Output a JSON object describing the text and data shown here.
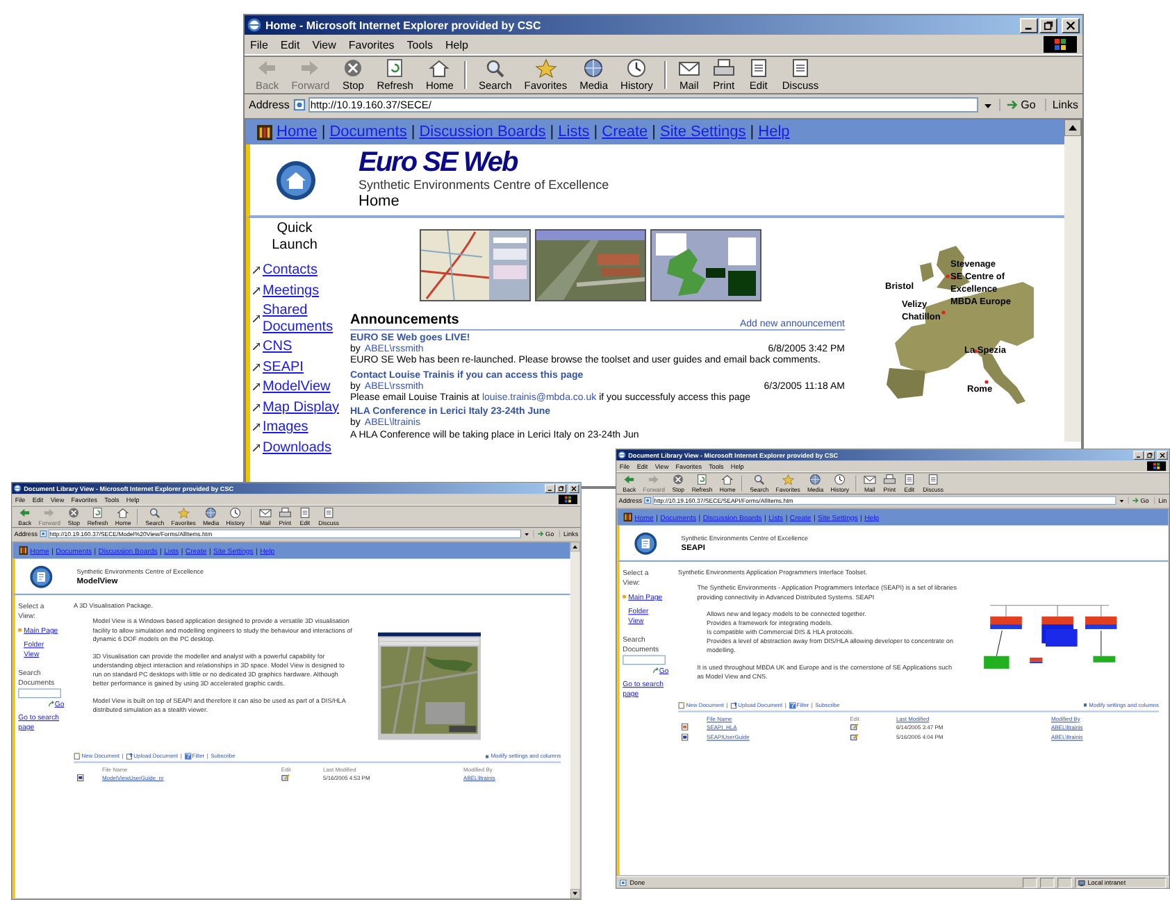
{
  "windows": [
    {
      "kind": "home",
      "title": "Home - Microsoft Internet Explorer provided by CSC",
      "menu": [
        "File",
        "Edit",
        "View",
        "Favorites",
        "Tools",
        "Help"
      ],
      "toolbar": [
        {
          "kind": "back",
          "label": "Back",
          "disabled": true
        },
        {
          "kind": "forward",
          "label": "Forward",
          "disabled": true
        },
        {
          "kind": "stop",
          "label": "Stop",
          "disabled": false
        },
        {
          "kind": "refresh",
          "label": "Refresh",
          "disabled": false
        },
        {
          "kind": "home",
          "label": "Home",
          "disabled": false
        },
        {
          "kind": "search",
          "label": "Search",
          "disabled": false
        },
        {
          "kind": "favorites",
          "label": "Favorites",
          "disabled": false
        },
        {
          "kind": "media",
          "label": "Media",
          "disabled": false
        },
        {
          "kind": "history",
          "label": "History",
          "disabled": false
        },
        {
          "kind": "mail",
          "label": "Mail",
          "disabled": false
        },
        {
          "kind": "print",
          "label": "Print",
          "disabled": false
        },
        {
          "kind": "edit",
          "label": "Edit",
          "disabled": false
        },
        {
          "kind": "discuss",
          "label": "Discuss",
          "disabled": false
        }
      ],
      "address": {
        "label": "Address",
        "url": "http://10.19.160.37/SECE/",
        "go": "Go",
        "links": "Links"
      },
      "nav": {
        "separator": "|",
        "links": [
          "Home",
          "Documents",
          "Discussion Boards",
          "Lists",
          "Create",
          "Site Settings",
          "Help"
        ]
      },
      "site_name": "Euro SE Web",
      "subtitle": "Synthetic Environments Centre of Excellence",
      "page_title": "Home",
      "quick_launch": {
        "heading": "Quick Launch",
        "links": [
          "Contacts",
          "Meetings",
          "Shared Documents",
          "CNS",
          "SEAPI",
          "ModelView",
          "Map Display",
          "Images",
          "Downloads"
        ]
      },
      "map_labels": [
        "Stevenage",
        "SE Centre of",
        "Excellence",
        "MBDA Europe",
        "Bristol",
        "Velizy",
        "Chatillon",
        "La Spezia",
        "Rome"
      ],
      "announcements": {
        "heading": "Announcements",
        "add_link": "Add new announcement",
        "items": [
          {
            "title": "EURO SE Web goes LIVE!",
            "by": "by",
            "author": "ABEL\\rssmith",
            "date": "6/8/2005 3:42 PM",
            "body": [
              {
                "text": "EURO SE Web has been re-launched.  Please browse the toolset and user guides and email back comments.",
                "link": false
              }
            ]
          },
          {
            "title": "Contact Louise Trainis if you can access this page",
            "by": "by",
            "author": "ABEL\\rssmith",
            "date": "6/3/2005 11:18 AM",
            "body": [
              {
                "text": "Please email Louise Trainis at ",
                "link": false
              },
              {
                "text": "louise.trainis@mbda.co.uk",
                "link": true
              },
              {
                "text": " if you successfuly access this page",
                "link": false
              }
            ]
          },
          {
            "title": "HLA Conference in Lerici Italy 23-24th June",
            "by": "by",
            "author": "ABEL\\ltrainis",
            "body": [
              {
                "text": "A HLA Conference will be taking place in Lerici Italy on 23-24th Jun",
                "link": false
              }
            ]
          }
        ]
      }
    },
    {
      "kind": "library",
      "title": "Document Library View - Microsoft Internet Explorer provided by CSC",
      "menu": [
        "File",
        "Edit",
        "View",
        "Favorites",
        "Tools",
        "Help"
      ],
      "toolbar": [
        {
          "kind": "back",
          "label": "Back",
          "disabled": false
        },
        {
          "kind": "forward",
          "label": "Forward",
          "disabled": true
        },
        {
          "kind": "stop",
          "label": "Stop",
          "disabled": false
        },
        {
          "kind": "refresh",
          "label": "Refresh",
          "disabled": false
        },
        {
          "kind": "home",
          "label": "Home",
          "disabled": false
        },
        {
          "kind": "search",
          "label": "Search",
          "disabled": false
        },
        {
          "kind": "favorites",
          "label": "Favorites",
          "disabled": false
        },
        {
          "kind": "media",
          "label": "Media",
          "disabled": false
        },
        {
          "kind": "history",
          "label": "History",
          "disabled": false
        },
        {
          "kind": "mail",
          "label": "Mail",
          "disabled": false
        },
        {
          "kind": "print",
          "label": "Print",
          "disabled": false
        },
        {
          "kind": "edit",
          "label": "Edit",
          "disabled": false
        },
        {
          "kind": "discuss",
          "label": "Discuss",
          "disabled": false
        }
      ],
      "address": {
        "label": "Address",
        "url": "http://10.19.160.37/SECE/Model%20View/Forms/AllItems.htm",
        "go": "Go",
        "links": "Links"
      },
      "nav": {
        "separator": "|",
        "links": [
          "Home",
          "Documents",
          "Discussion Boards",
          "Lists",
          "Create",
          "Site Settings",
          "Help"
        ]
      },
      "subtitle": "Synthetic Environments Centre of Excellence",
      "page_title": "ModelView",
      "select_view": {
        "heading": "Select a View:",
        "items": [
          {
            "label": "Main Page",
            "selected": true
          },
          {
            "label": "Folder View",
            "selected": false
          }
        ]
      },
      "search": {
        "heading": "Search Documents",
        "go": "Go",
        "search_page": "Go to search page"
      },
      "intro": "A 3D Visualisation Package.",
      "blocks": [
        {
          "kind": "para",
          "text": "Model View is a Windows based application designed to provide a versatile 3D visualisation facility to allow simulation and modelling engineers to study the behaviour and interactions of dynamic 6 DOF models on the PC desktop."
        },
        {
          "kind": "para",
          "text": "3D Visualisation can provide the modeller and analyst with a powerful capability for understanding object interaction and relationships in 3D space. Model View is designed to run on standard PC desktops with little or no dedicated 3D graphics hardware. Although better performance is gained by using 3D accelerated graphic cards."
        },
        {
          "kind": "para",
          "text": "Model View is built on top of SEAPI and therefore it can also be used as part of a DIS/HLA distributed simulation as a stealth viewer."
        }
      ],
      "figure": {
        "kind": "screenshot"
      },
      "doc_toolbar": {
        "separator": "|",
        "actions": [
          {
            "kind": "new",
            "label": "New Document"
          },
          {
            "kind": "upload",
            "label": "Upload Document"
          },
          {
            "kind": "filter",
            "label": "Filter"
          },
          {
            "kind": "subscribe",
            "label": "Subscribe"
          }
        ],
        "modify": "Modify settings and columns"
      },
      "table": {
        "columns": [
          {
            "label": "File Name",
            "sortable": false
          },
          {
            "label": "Edit",
            "sortable": false
          },
          {
            "label": "Last Modified",
            "sortable": false
          },
          {
            "label": "Modified By",
            "sortable": false
          }
        ],
        "rows": [
          {
            "kind": "doc",
            "file_name": "ModelViewUserGuide_nr",
            "modified": "5/16/2005 4:53 PM",
            "modified_by": "ABEL\\ltrainis"
          }
        ]
      }
    },
    {
      "kind": "library",
      "title": "Document Library View - Microsoft Internet Explorer provided by CSC",
      "menu": [
        "File",
        "Edit",
        "View",
        "Favorites",
        "Tools",
        "Help"
      ],
      "toolbar": [
        {
          "kind": "back",
          "label": "Back",
          "disabled": false
        },
        {
          "kind": "forward",
          "label": "Forward",
          "disabled": true
        },
        {
          "kind": "stop",
          "label": "Stop",
          "disabled": false
        },
        {
          "kind": "refresh",
          "label": "Refresh",
          "disabled": false
        },
        {
          "kind": "home",
          "label": "Home",
          "disabled": false
        },
        {
          "kind": "search",
          "label": "Search",
          "disabled": false
        },
        {
          "kind": "favorites",
          "label": "Favorites",
          "disabled": false
        },
        {
          "kind": "media",
          "label": "Media",
          "disabled": false
        },
        {
          "kind": "history",
          "label": "History",
          "disabled": false
        },
        {
          "kind": "mail",
          "label": "Mail",
          "disabled": false
        },
        {
          "kind": "print",
          "label": "Print",
          "disabled": false
        },
        {
          "kind": "edit",
          "label": "Edit",
          "disabled": false
        },
        {
          "kind": "discuss",
          "label": "Discuss",
          "disabled": false
        }
      ],
      "address": {
        "label": "Address",
        "url": "http://10.19.160.37/SECE/SEAPI/Forms/AllItems.htm",
        "go": "Go",
        "links": "Lin"
      },
      "nav": {
        "separator": "|",
        "links": [
          "Home",
          "Documents",
          "Discussion Boards",
          "Lists",
          "Create",
          "Site Settings",
          "Help"
        ]
      },
      "subtitle": "Synthetic Environments Centre of Excellence",
      "page_title": "SEAPI",
      "select_view": {
        "heading": "Select a View:",
        "items": [
          {
            "label": "Main Page",
            "selected": true
          },
          {
            "label": "Folder View",
            "selected": false
          }
        ]
      },
      "search": {
        "heading": "Search Documents",
        "go": "Go",
        "search_page": "Go to search page"
      },
      "intro": "Synthetic Environments Application Programmers Interface Toolset.",
      "blocks": [
        {
          "kind": "para",
          "text": "The Synthetic Environments - Application Programmers Interface (SEAPI) is a set of libraries providing connectivity in Advanced Distributed Systems. SEAPI"
        },
        {
          "kind": "bullet",
          "text": "Allows new and legacy models to be connected together."
        },
        {
          "kind": "bullet",
          "text": "Provides a framework for integrating models."
        },
        {
          "kind": "bullet",
          "text": "Is compatible with Commercial DIS & HLA protocols."
        },
        {
          "kind": "bullet",
          "text": "Provides a level of abstraction away from DIS/HLA allowing developer to concentrate on modelling."
        },
        {
          "kind": "para",
          "text": "It is used throughout MBDA UK and Europe and is the cornerstone of SE Applications such as Model View and CNS."
        }
      ],
      "figure": {
        "kind": "diagram"
      },
      "doc_toolbar": {
        "separator": "|",
        "actions": [
          {
            "kind": "new",
            "label": "New Document"
          },
          {
            "kind": "upload",
            "label": "Upload Document"
          },
          {
            "kind": "filter",
            "label": "Filter"
          },
          {
            "kind": "subscribe",
            "label": "Subscribe"
          }
        ],
        "modify": "Modify settings and columns"
      },
      "table": {
        "columns": [
          {
            "label": "File Name",
            "sortable": true
          },
          {
            "label": "Edit",
            "sortable": false
          },
          {
            "label": "Last Modified",
            "sortable": true
          },
          {
            "label": "Modified By",
            "sortable": true
          }
        ],
        "rows": [
          {
            "kind": "slides",
            "file_name": "SEAPI_HLA",
            "modified": "6/14/2005 3:47 PM",
            "modified_by": "ABEL\\ltrainis"
          },
          {
            "kind": "doc",
            "file_name": "SEAPIUserGuide",
            "modified": "5/16/2005 4:04 PM",
            "modified_by": "ABEL\\ltrainis"
          }
        ]
      },
      "status_bar": {
        "text": "Done",
        "zone": "Local intranet"
      }
    }
  ]
}
